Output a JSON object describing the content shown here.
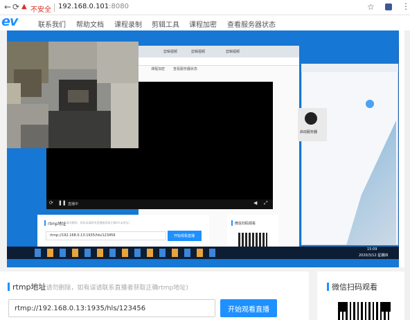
{
  "browser": {
    "security_label": "不安全",
    "address": "192.168.0.101",
    "port": ":8080"
  },
  "site": {
    "logo": "ev",
    "nav": [
      "联系我们",
      "帮助文档",
      "课程录制",
      "剪辑工具",
      "课程加密",
      "查看服务器状态"
    ]
  },
  "shared_screen": {
    "inner_tabs": [
      "剪辑视频",
      "剪辑视频",
      "剪辑视频"
    ],
    "inner_nav": [
      "课程加密",
      "查看服务器状态"
    ],
    "player_time": "直播中",
    "rtmp_title_small": "rtmp地址",
    "rtmp_hint_small": "(请勿删除，如有误请联系直播者获取正确rtmp地址)",
    "rtmp_value_small": "rtmp://192.168.0.13:1935/hls/123456",
    "watch_button_small": "开始观看直播",
    "wechat_title_small": "微信扫码观看",
    "desktop_icon_label": "启动服务器",
    "clock_time": "15:09",
    "clock_date": "2020/3/12 星期四"
  },
  "rtmp_panel": {
    "title": "rtmp地址",
    "hint": "(请勿删除，如有误请联系直播者获取正确rtmp地址)",
    "url_value": "rtmp://192.168.0.13:1935/hls/123456",
    "watch_button": "开始观看直播"
  },
  "wechat_panel": {
    "title": "微信扫码观看"
  },
  "colors": {
    "accent": "#1e90ff",
    "warning": "#d93025",
    "stage_blue": "#1677d4"
  }
}
